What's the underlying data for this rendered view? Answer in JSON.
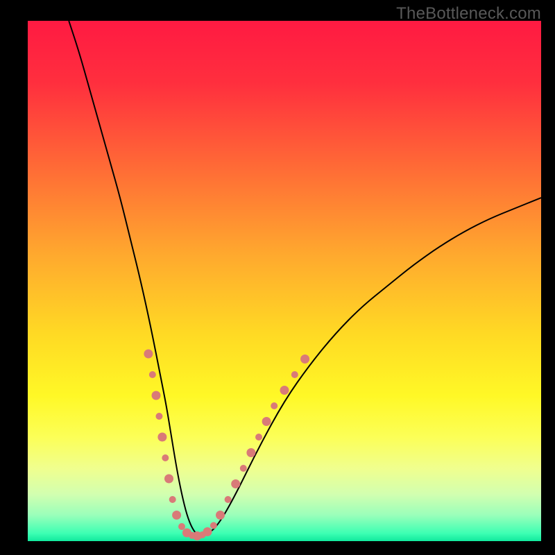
{
  "watermark": "TheBottleneck.com",
  "chart_data": {
    "type": "line",
    "title": "",
    "xlabel": "",
    "ylabel": "",
    "xlim": [
      0,
      100
    ],
    "ylim": [
      0,
      100
    ],
    "grid": false,
    "legend": false,
    "gradient_stops": [
      {
        "offset": 0.0,
        "color": "#ff1a42"
      },
      {
        "offset": 0.12,
        "color": "#ff2f3e"
      },
      {
        "offset": 0.28,
        "color": "#ff6a36"
      },
      {
        "offset": 0.45,
        "color": "#ffa92e"
      },
      {
        "offset": 0.6,
        "color": "#ffd924"
      },
      {
        "offset": 0.72,
        "color": "#fff826"
      },
      {
        "offset": 0.8,
        "color": "#fcff57"
      },
      {
        "offset": 0.86,
        "color": "#f0ff8e"
      },
      {
        "offset": 0.91,
        "color": "#d2ffb0"
      },
      {
        "offset": 0.95,
        "color": "#9affba"
      },
      {
        "offset": 0.985,
        "color": "#3dffb3"
      },
      {
        "offset": 1.0,
        "color": "#11e99d"
      }
    ],
    "series": [
      {
        "name": "bottleneck-curve",
        "color": "#000000",
        "x": [
          8,
          10,
          12,
          14,
          16,
          18,
          20,
          22,
          24,
          26,
          27,
          28,
          29,
          30,
          31,
          32,
          33,
          34,
          35,
          37,
          40,
          45,
          50,
          55,
          60,
          65,
          70,
          75,
          80,
          85,
          90,
          95,
          100
        ],
        "y": [
          100,
          94,
          87,
          80,
          73,
          66,
          58,
          50,
          41,
          31,
          26,
          20,
          14,
          9,
          5,
          2.5,
          1.2,
          1.0,
          1.3,
          3,
          8,
          18,
          27,
          34,
          40,
          45,
          49,
          53,
          56.5,
          59.5,
          62,
          64,
          66
        ]
      }
    ],
    "markers": {
      "color": "#d97a78",
      "radius_large": 6.5,
      "radius_small": 5,
      "points": [
        {
          "x": 23.5,
          "y": 36,
          "r": "large"
        },
        {
          "x": 24.3,
          "y": 32,
          "r": "small"
        },
        {
          "x": 25.0,
          "y": 28,
          "r": "large"
        },
        {
          "x": 25.6,
          "y": 24,
          "r": "small"
        },
        {
          "x": 26.2,
          "y": 20,
          "r": "large"
        },
        {
          "x": 26.8,
          "y": 16,
          "r": "small"
        },
        {
          "x": 27.5,
          "y": 12,
          "r": "large"
        },
        {
          "x": 28.2,
          "y": 8,
          "r": "small"
        },
        {
          "x": 29.0,
          "y": 5,
          "r": "large"
        },
        {
          "x": 30.0,
          "y": 2.8,
          "r": "small"
        },
        {
          "x": 31.0,
          "y": 1.6,
          "r": "large"
        },
        {
          "x": 32.0,
          "y": 1.1,
          "r": "small"
        },
        {
          "x": 33.0,
          "y": 1.0,
          "r": "large"
        },
        {
          "x": 34.0,
          "y": 1.2,
          "r": "small"
        },
        {
          "x": 35.0,
          "y": 1.8,
          "r": "large"
        },
        {
          "x": 36.2,
          "y": 3.0,
          "r": "small"
        },
        {
          "x": 37.5,
          "y": 5.0,
          "r": "large"
        },
        {
          "x": 39.0,
          "y": 8.0,
          "r": "small"
        },
        {
          "x": 40.5,
          "y": 11,
          "r": "large"
        },
        {
          "x": 42.0,
          "y": 14,
          "r": "small"
        },
        {
          "x": 43.5,
          "y": 17,
          "r": "large"
        },
        {
          "x": 45.0,
          "y": 20,
          "r": "small"
        },
        {
          "x": 46.5,
          "y": 23,
          "r": "large"
        },
        {
          "x": 48.0,
          "y": 26,
          "r": "small"
        },
        {
          "x": 50.0,
          "y": 29,
          "r": "large"
        },
        {
          "x": 52.0,
          "y": 32,
          "r": "small"
        },
        {
          "x": 54.0,
          "y": 35,
          "r": "large"
        }
      ]
    }
  }
}
